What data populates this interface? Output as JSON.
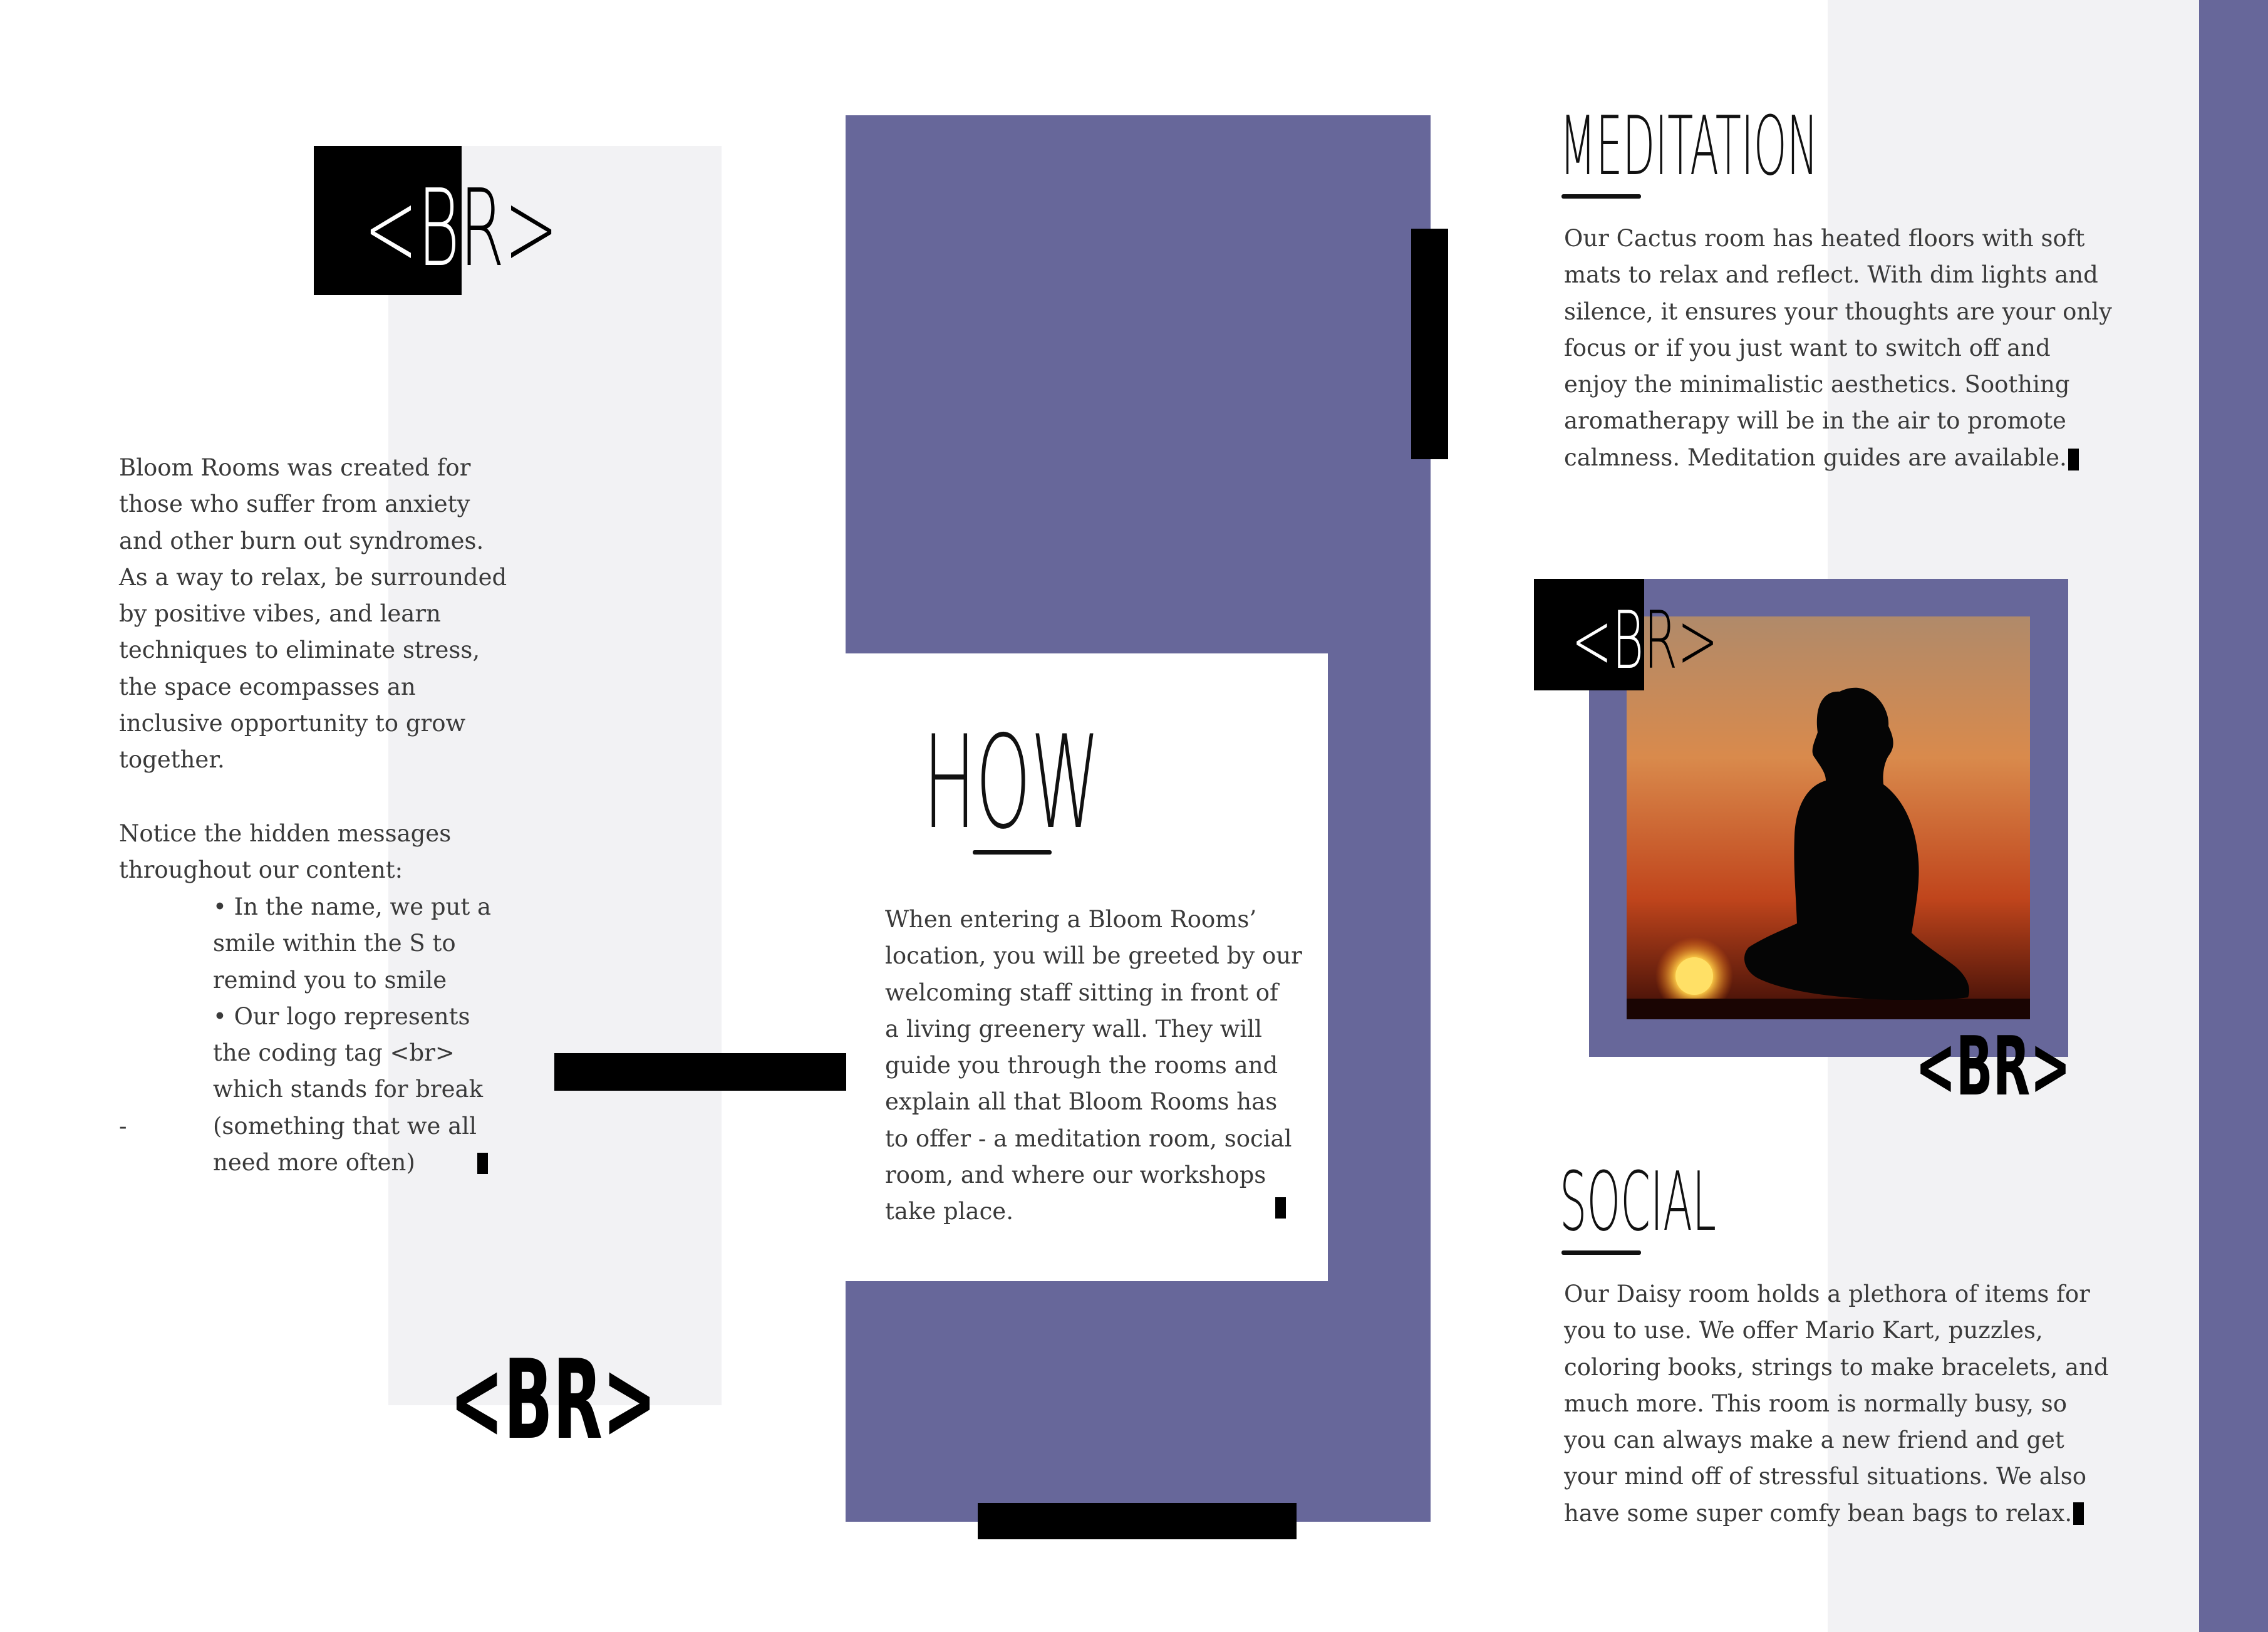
{
  "colors": {
    "accent_purple": "#67679a",
    "light_gray": "#f2f2f4",
    "black": "#000000",
    "white": "#ffffff"
  },
  "logo": {
    "text": "<BR>"
  },
  "intro": {
    "paragraph_lines": [
      "Bloom Rooms was created for",
      "those who suffer from anxiety",
      "and other burn out syndromes.",
      "As a way to relax, be surrounded",
      "by positive vibes, and learn",
      "techniques to eliminate stress,",
      "the space ecompasses an",
      "inclusive opportunity to grow",
      "together."
    ],
    "notice_lines": [
      "Notice the hidden messages",
      "throughout our content:"
    ],
    "bullet_lines": [
      "• In the name, we put a",
      "smile within the S to",
      "remind you to smile",
      "• Our logo represents",
      "the coding tag <br>",
      "which stands for break",
      "(something that we all",
      "need more often)"
    ],
    "dash": "-"
  },
  "how": {
    "title": "HOW",
    "lines": [
      "When entering a Bloom Rooms’",
      "location, you will be greeted by our",
      "welcoming staff sitting in front of",
      "a living greenery wall. They will",
      "guide you through the rooms and",
      "explain all that Bloom Rooms has",
      "to offer - a meditation room, social",
      "room, and where our workshops",
      "take place."
    ]
  },
  "meditation": {
    "title": "MEDITATION",
    "lines": [
      "Our Cactus room has heated floors with soft",
      "mats to relax and reflect. With dim lights and",
      "silence, it ensures your thoughts are your only",
      "focus or if you just want to switch off and",
      "enjoy the minimalistic aesthetics. Soothing",
      "aromatherapy will be in the air to promote",
      "calmness. Meditation guides are available."
    ]
  },
  "social": {
    "title": "SOCIAL",
    "lines": [
      "Our Daisy room holds a plethora of items for",
      "you to use. We offer Mario Kart, puzzles,",
      "coloring books, strings to make bracelets, and",
      "much more. This room is normally busy, so",
      "you can always make a new friend and get",
      "your mind off of stressful situations. We also",
      "have some super comfy bean bags to relax."
    ]
  }
}
